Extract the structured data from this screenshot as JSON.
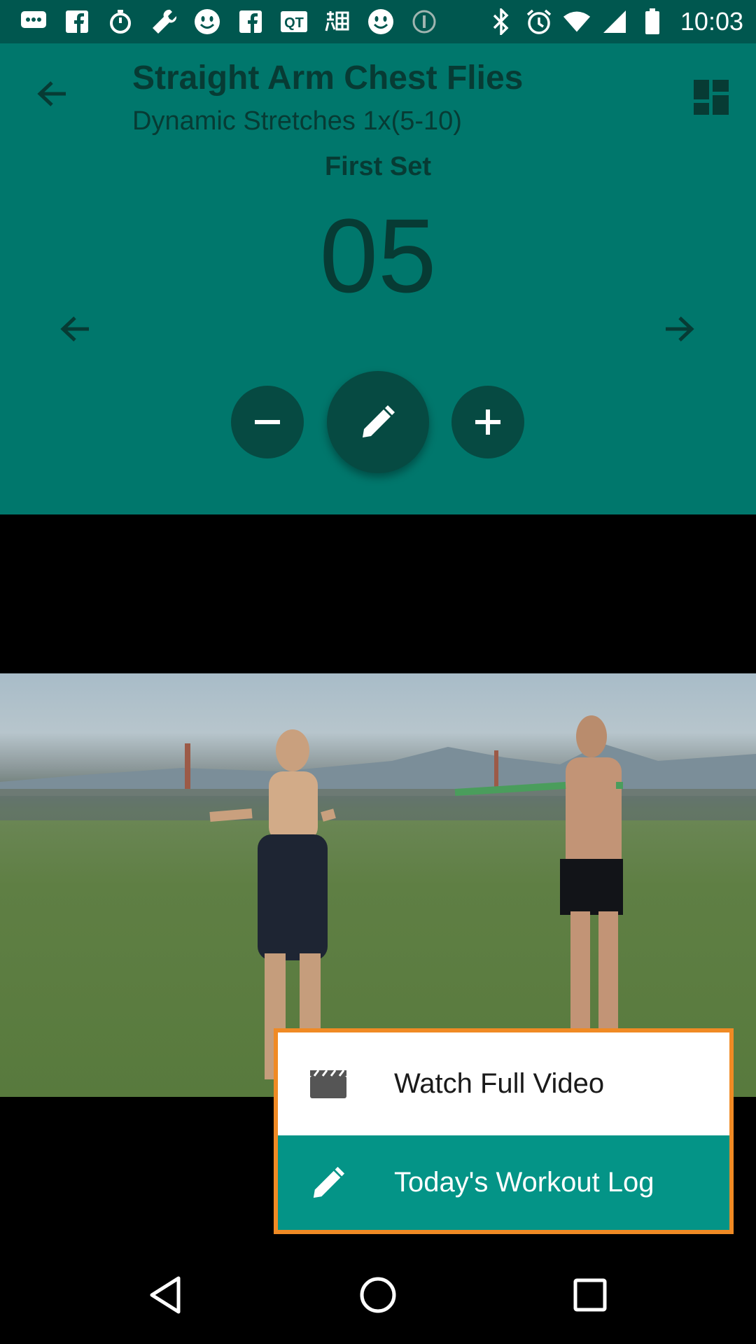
{
  "status_bar": {
    "time": "10:03",
    "left_icons": [
      "message-icon",
      "facebook-icon",
      "stopwatch-icon",
      "wrench-icon",
      "smiley-icon",
      "facebook-icon",
      "qt-icon",
      "taobao-icon",
      "smiley-icon",
      "coin-icon"
    ],
    "right_icons": [
      "bluetooth-icon",
      "alarm-icon",
      "wifi-icon",
      "signal-icon",
      "battery-icon"
    ]
  },
  "exercise": {
    "title": "Straight Arm Chest Flies",
    "subtitle": "Dynamic Stretches 1x(5-10)",
    "set_label": "First Set",
    "rep_count": "05"
  },
  "colors": {
    "panel": "#00776c",
    "status_bar": "#00574f",
    "text_dark": "#073b34",
    "button": "#064a42",
    "menu_highlight": "#049487",
    "menu_border": "#f08a24"
  },
  "menu": {
    "watch_label": "Watch Full Video",
    "log_label": "Today's Workout Log"
  }
}
